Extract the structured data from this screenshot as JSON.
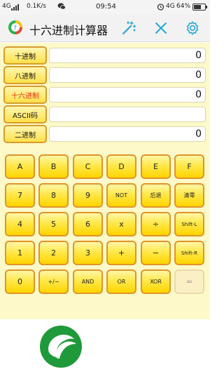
{
  "status_bar": {
    "network": "4G",
    "speed": "0.1K/s",
    "time": "09:54",
    "network_right": "4G",
    "battery": "64%"
  },
  "app": {
    "title": "十六进制计算器"
  },
  "bases": [
    {
      "label": "十进制",
      "value": "0",
      "active": false
    },
    {
      "label": "八进制",
      "value": "0",
      "active": false
    },
    {
      "label": "十六进制",
      "value": "0",
      "active": true
    },
    {
      "label": "ASCII码",
      "value": "",
      "active": false
    },
    {
      "label": "二进制",
      "value": "0",
      "active": false
    }
  ],
  "keypad": [
    [
      "A",
      "B",
      "C",
      "D",
      "E",
      "F"
    ],
    [
      "7",
      "8",
      "9",
      "NOT",
      "后退",
      "清零"
    ],
    [
      "4",
      "5",
      "6",
      "x",
      "÷",
      "Shift-L"
    ],
    [
      "1",
      "2",
      "3",
      "+",
      "−",
      "Shift-R"
    ],
    [
      "0",
      "+/−",
      "AND",
      "OR",
      "XOR",
      "="
    ]
  ],
  "icons": {
    "brush": "magic-wand-icon",
    "close": "close-icon",
    "settings": "gear-icon",
    "logo": "app-logo-icon",
    "brand": "leaf-logo-icon"
  },
  "colors": {
    "accent": "#2aa6d8",
    "active_label": "#e53012",
    "key_border": "#e0942a",
    "key_fill": "#ffe84a",
    "panel_bg": "#fdf9c8",
    "brand_green": "#1f9a3a"
  }
}
